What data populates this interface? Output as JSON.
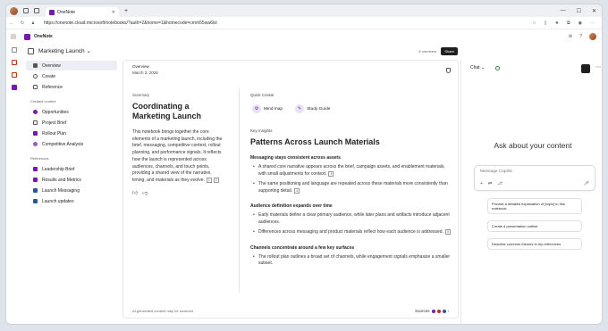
{
  "browser": {
    "tab_title": "OneNote",
    "url": "https://onenote.cloud.microsoft/notebooks/?auth=2&home=1&homecode=cmm55wa6lsl"
  },
  "app": {
    "title": "OneNote"
  },
  "notebook": {
    "title": "Marketing Launch",
    "members": "5 members",
    "share_label": "Share"
  },
  "sidebar": {
    "items": [
      {
        "label": "Overview"
      },
      {
        "label": "Create"
      },
      {
        "label": "Reference"
      }
    ],
    "created_heading": "Created content",
    "created": [
      {
        "label": "Opportunities"
      },
      {
        "label": "Project Brief"
      },
      {
        "label": "Rollout Plan"
      },
      {
        "label": "Competitive Analysis"
      }
    ],
    "references_heading": "References",
    "references": [
      {
        "label": "Leadership Brief"
      },
      {
        "label": "Results and Metrics"
      },
      {
        "label": "Launch Messaging"
      },
      {
        "label": "Launch updates"
      }
    ]
  },
  "overview": {
    "heading": "Overview",
    "date": "March 3, 2026"
  },
  "summary": {
    "label": "Summary",
    "title": "Coordinating a Marketing Launch",
    "body": "This notebook brings together the core elements of a marketing launch, including the brief, messaging, competitive context, rollout planning, and performance signals. It reflects how the launch is represented across audiences, channels, and touch points, providing a shared view of the narrative, timing, and materials as they evolve.",
    "cite1": "1",
    "cite2": "2"
  },
  "quick_create": {
    "label": "Quick Create",
    "buttons": [
      {
        "label": "Mind map"
      },
      {
        "label": "Study Guide"
      }
    ]
  },
  "insights": {
    "label": "Key Insights",
    "title": "Patterns Across Launch Materials",
    "sections": [
      {
        "heading": "Messaging stays consistent across assets",
        "bullets": [
          {
            "text": "A shared core narrative appears across the brief, campaign assets, and enablement materials, with small adjustments for context.",
            "cite": "3"
          },
          {
            "text": "The same positioning and language are repeated across these materials more consistently than supporting detail.",
            "cite": "4"
          }
        ]
      },
      {
        "heading": "Audience definition expands over time",
        "bullets": [
          {
            "text": "Early materials define a clear primary audience, while later plans and artifacts introduce adjacent audiences.",
            "cite": ""
          },
          {
            "text": "Differences across messaging and product materials reflect how each audience is addressed.",
            "cite": "5"
          }
        ]
      },
      {
        "heading": "Channels concentrate around a few key surfaces",
        "bullets": [
          {
            "text": "The rollout plan outlines a broad set of channels, while engagement signals emphasize a smaller subset.",
            "cite": ""
          }
        ]
      }
    ]
  },
  "footer": {
    "disclaimer": "AI-generated content may be incorrect",
    "sources_label": "Sources"
  },
  "chat": {
    "label": "Chat",
    "heading": "Ask about your content",
    "input_placeholder": "Message Copilot",
    "suggestions": [
      {
        "text": "Provide a detailed explanation of {topic} in this notebook"
      },
      {
        "text": "Create a presentation outline"
      },
      {
        "text": "Describe common themes in my references"
      }
    ]
  },
  "colors": {
    "accent": "#7719aa",
    "brand_red": "#c42b1c"
  }
}
